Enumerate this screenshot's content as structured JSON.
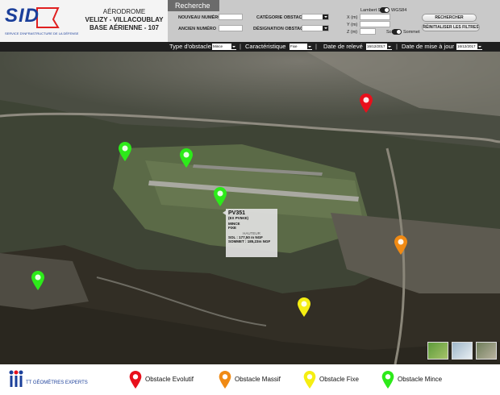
{
  "header": {
    "logo_text": "SID",
    "logo_sub": "SERVICE D'INFRASTRUCTURE DE LA DÉFENSE",
    "aerodrome": "AÉRODROME",
    "name_line1": "VELIZY - VILLACOUBLAY",
    "name_line2": "BASE AÉRIENNE - 107"
  },
  "search": {
    "tab": "Recherche",
    "new_number": "NOUVEAU NUMÉRO",
    "old_number": "ANCIEN NUMÉRO",
    "category": "CATÉGORIE OBSTACLE",
    "designation": "DÉSIGNATION OBSTACLE",
    "lambert": "Lambert 93",
    "wgs": "WGS84",
    "x": "X (m)",
    "y": "Y (m)",
    "z": "Z (m)",
    "sol": "Sol",
    "sommet": "Sommet",
    "btn_search": "RECHERCHER",
    "btn_reset": "RÉINITIALISER LES FILTRES"
  },
  "filters": {
    "type_label": "Type d'obstacle",
    "type_value": "Mince",
    "char_label": "Caractéristique",
    "char_value": "Fixe",
    "date_releve_label": "Date de relevé",
    "date_releve_value": "16/12/2017",
    "date_maj_label": "Date de mise à jour",
    "date_maj_value": "16/12/2017"
  },
  "popup": {
    "id": "PV351",
    "old_id": "(EX PV5KE)",
    "type": "MINCE",
    "char": "FIXE",
    "height_title": "HAUTEUR",
    "sol": "SOL : 177,50 m NGF",
    "sommet": "SOMMET : 185,23m NGF"
  },
  "markers": [
    {
      "name": "red",
      "color": "#e8101c"
    },
    {
      "name": "green",
      "color": "#2dea1a"
    },
    {
      "name": "green",
      "color": "#2dea1a"
    },
    {
      "name": "green",
      "color": "#2dea1a"
    },
    {
      "name": "green",
      "color": "#2dea1a"
    },
    {
      "name": "orange",
      "color": "#f08a14"
    },
    {
      "name": "yellow",
      "color": "#f5ee12"
    }
  ],
  "footer": {
    "company": "TT GÉOMÈTRES EXPERTS",
    "legend": [
      {
        "label": "Obstacle Evolutif",
        "color": "#e8101c"
      },
      {
        "label": "Obstacle Massif",
        "color": "#f08a14"
      },
      {
        "label": "Obstacle Fixe",
        "color": "#f5ee12"
      },
      {
        "label": "Obstacle Mince",
        "color": "#2dea1a"
      }
    ]
  }
}
